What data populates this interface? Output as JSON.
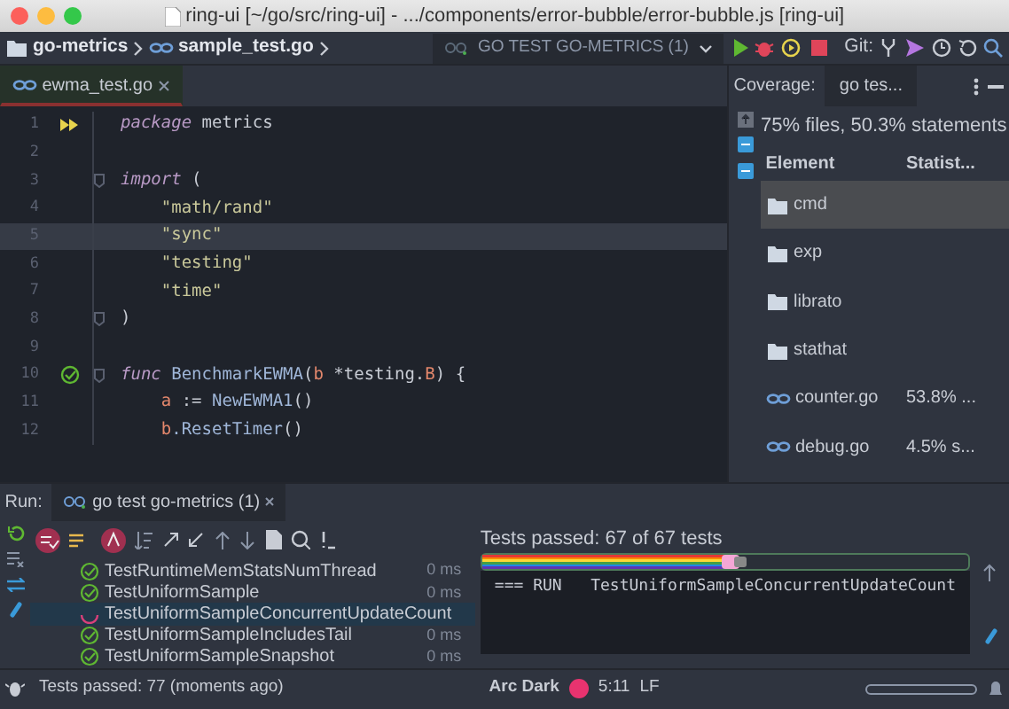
{
  "window": {
    "title": "ring-ui [~/go/src/ring-ui] - .../components/error-bubble/error-bubble.js [ring-ui]"
  },
  "navbar": {
    "breadcrumbs": [
      {
        "label": "go-metrics",
        "kind": "folder"
      },
      {
        "label": "sample_test.go",
        "kind": "file"
      }
    ],
    "run_config": "GO TEST GO-METRICS (1)",
    "git_label": "Git:"
  },
  "editor_tabs": [
    {
      "label": "ewma_test.go",
      "selected": true
    }
  ],
  "code": [
    {
      "number": "1",
      "kind": "runnable",
      "current": false,
      "fold": false,
      "tokens": [
        {
          "text": "package",
          "kind": "keyword"
        },
        {
          "text": " metrics",
          "kind": "plain"
        }
      ]
    },
    {
      "number": "2",
      "kind": "plain",
      "current": false,
      "fold": false
    },
    {
      "number": "3",
      "kind": "plain",
      "fold": true,
      "current": false,
      "tokens": [
        {
          "text": "import",
          "kind": "keyword"
        },
        {
          "text": " (",
          "kind": "plain"
        }
      ]
    },
    {
      "number": "4",
      "kind": "plain",
      "indented": true,
      "current": false,
      "fold": false,
      "tokens": [
        {
          "text": "\"math/rand\"",
          "kind": "string"
        }
      ]
    },
    {
      "number": "5",
      "kind": "plain",
      "indented": true,
      "current": true,
      "fold": false,
      "tokens": [
        {
          "text": "\"sync\"",
          "kind": "string"
        }
      ]
    },
    {
      "number": "6",
      "kind": "plain",
      "indented": true,
      "current": false,
      "fold": false,
      "tokens": [
        {
          "text": "\"testing\"",
          "kind": "string"
        }
      ]
    },
    {
      "number": "7",
      "kind": "plain",
      "indented": true,
      "current": false,
      "fold": false,
      "tokens": [
        {
          "text": "\"time\"",
          "kind": "string"
        }
      ]
    },
    {
      "number": "8",
      "kind": "plain",
      "fold": true,
      "current": false,
      "tokens": [
        {
          "text": ")",
          "kind": "plain"
        }
      ]
    },
    {
      "number": "9",
      "kind": "plain",
      "current": false,
      "fold": false
    },
    {
      "number": "10",
      "kind": "passed",
      "fold": true,
      "current": false,
      "tokens": [
        {
          "text": "func",
          "kind": "keyword"
        },
        {
          "text": " BenchmarkEWMA",
          "kind": "func"
        },
        {
          "text": "(",
          "kind": "plain"
        },
        {
          "text": "b",
          "kind": "param"
        },
        {
          "text": " *testing.",
          "kind": "plain"
        },
        {
          "text": "B",
          "kind": "param"
        },
        {
          "text": ") {",
          "kind": "plain"
        }
      ]
    },
    {
      "number": "11",
      "kind": "plain",
      "indented": true,
      "current": false,
      "fold": false,
      "tokens": [
        {
          "text": "a",
          "kind": "param"
        },
        {
          "text": " := ",
          "kind": "plain"
        },
        {
          "text": "NewEWMA1",
          "kind": "func"
        },
        {
          "text": "()",
          "kind": "plain"
        }
      ]
    },
    {
      "number": "12",
      "kind": "plain",
      "indented": true,
      "current": false,
      "fold": false,
      "tokens": [
        {
          "text": "b",
          "kind": "param"
        },
        {
          "text": ".ResetTimer",
          "kind": "func"
        },
        {
          "text": "()",
          "kind": "plain"
        }
      ]
    }
  ],
  "coverage": {
    "title": "Coverage:",
    "tab": "go tes...",
    "summary": "75% files, 50.3% statements",
    "columns": [
      "Element",
      "Statist..."
    ],
    "rows": [
      {
        "name": "cmd",
        "kind": "folder",
        "selected": true
      },
      {
        "name": "exp",
        "kind": "folder",
        "selected": false
      },
      {
        "name": "librato",
        "kind": "folder",
        "selected": false
      },
      {
        "name": "stathat",
        "kind": "folder",
        "selected": false
      },
      {
        "name": "counter.go",
        "kind": "file",
        "value": "53.8% ...",
        "selected": false
      },
      {
        "name": "debug.go",
        "kind": "file",
        "value": "4.5% s...",
        "selected": false
      }
    ]
  },
  "run": {
    "label": "Run:",
    "tab": "go test go-metrics (1)",
    "tests": [
      {
        "name": "TestRuntimeMemStatsNumThread",
        "duration": "0 ms",
        "kind": "passed",
        "selected": false
      },
      {
        "name": "TestUniformSample",
        "duration": "0 ms",
        "kind": "passed",
        "selected": false
      },
      {
        "name": "TestUniformSampleConcurrentUpdateCount",
        "kind": "running",
        "selected": true
      },
      {
        "name": "TestUniformSampleIncludesTail",
        "duration": "0 ms",
        "kind": "passed",
        "selected": false
      },
      {
        "name": "TestUniformSampleSnapshot",
        "duration": "0 ms",
        "kind": "passed",
        "selected": false
      }
    ],
    "result": "Tests passed: 67 of 67 tests",
    "level": 0.5,
    "console": [
      "=== RUN   TestUniformSampleConcurrentUpdateCount"
    ]
  },
  "status_bar": {
    "message": "Tests passed: 77 (moments ago)",
    "theme": "Arc Dark",
    "position": "5:11",
    "line_ending": "LF"
  }
}
